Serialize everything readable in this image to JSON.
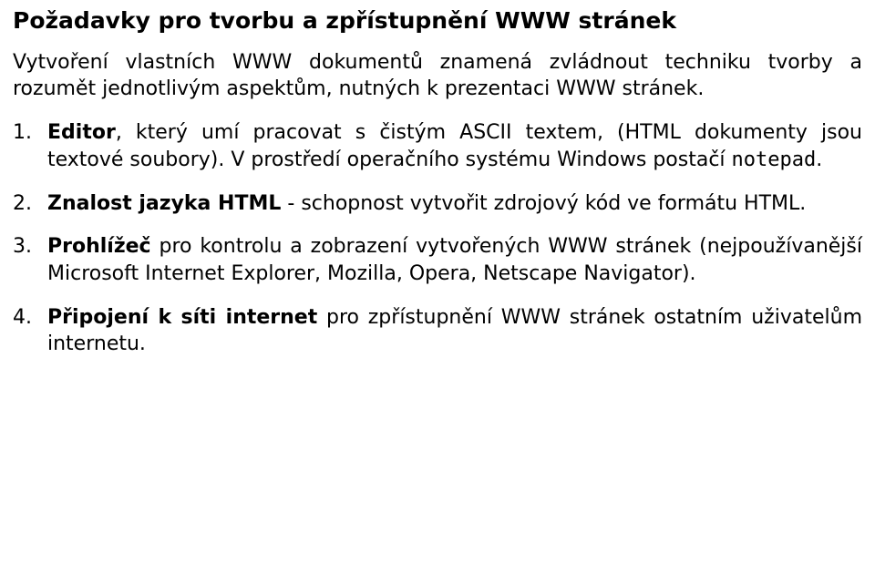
{
  "title": "Požadavky pro tvorbu a zpřístupnění WWW stránek",
  "intro": "Vytvoření vlastních WWW dokumentů znamená zvládnout techniku tvorby a rozumět jednotlivým aspektům, nutných k prezentaci WWW stránek.",
  "items": [
    {
      "num": "1.",
      "lead": "Editor",
      "rest_before_mono": ", který umí pracovat s čistým ASCII textem, (HTML dokumenty jsou textové soubory). V prostředí operačního systému Windows postačí ",
      "mono": "notepad",
      "rest_after_mono": "."
    },
    {
      "num": "2.",
      "lead": "Znalost jazyka HTML",
      "rest_before_mono": " - schopnost vytvořit zdrojový kód ve formátu HTML.",
      "mono": "",
      "rest_after_mono": ""
    },
    {
      "num": "3.",
      "lead": "Prohlížeč",
      "rest_before_mono": " pro kontrolu a zobrazení vytvořených WWW stránek (nejpoužívanější Microsoft Internet Explorer, Mozilla, Opera, Netscape Navigator).",
      "mono": "",
      "rest_after_mono": ""
    },
    {
      "num": "4.",
      "lead": "Připojení k síti internet",
      "rest_before_mono": " pro zpřístupnění WWW stránek ostatním uživatelům internetu.",
      "mono": "",
      "rest_after_mono": ""
    }
  ]
}
